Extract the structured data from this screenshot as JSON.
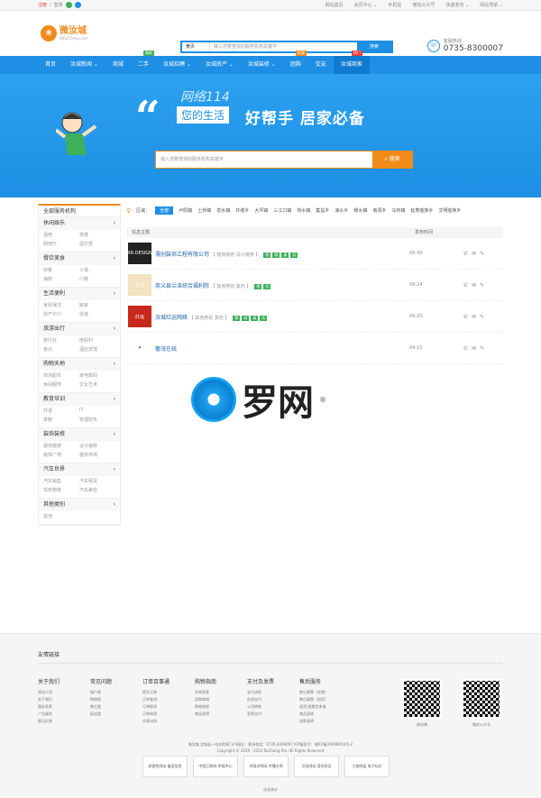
{
  "topbar": {
    "login": "注册",
    "sep": "/",
    "register": "登录",
    "links": [
      "网站首页",
      "会员中心 ⌄",
      "手机站",
      "微信公众号",
      "快速发布 ⌄",
      "网站导航 ⌄"
    ]
  },
  "header": {
    "logo_text": "微汝城",
    "logo_sub": "WRuCheng.com",
    "search_select": "黄页",
    "search_placeholder": "输入您要查找的服务机构关键字",
    "search_button": "搜索",
    "hotline_label": "客服热线",
    "hotline_number": "0735-8300007"
  },
  "nav": {
    "items": [
      {
        "label": "首页",
        "badge": ""
      },
      {
        "label": "汝城新闻 ⌄",
        "badge": ""
      },
      {
        "label": "商城",
        "badge": ""
      },
      {
        "label": "二手",
        "badge": "最新"
      },
      {
        "label": "汝城招聘 ⌄",
        "badge": ""
      },
      {
        "label": "汝城房产 ⌄",
        "badge": ""
      },
      {
        "label": "汝城装修 ⌄",
        "badge": ""
      },
      {
        "label": "团购",
        "badge": "优惠"
      },
      {
        "label": "交友",
        "badge": ""
      },
      {
        "label": "汝城商家",
        "badge": "热门"
      }
    ]
  },
  "banner": {
    "net": "网络114",
    "quote": "“",
    "life": "您的生活",
    "slogan": "好帮手 居家必备",
    "search_placeholder": "输入您要查找的服务机构关键字",
    "search_button": "搜索"
  },
  "sidebar": {
    "title": "全部服务机构",
    "cats": [
      {
        "name": "休闲娱乐",
        "links": [
          "酒吧",
          "茶楼",
          "网吧厅",
          "俱乐部"
        ]
      },
      {
        "name": "餐饮美食",
        "links": [
          "快餐",
          "火锅",
          "海鲜",
          "川菜"
        ]
      },
      {
        "name": "生活便利",
        "links": [
          "家政保洁",
          "搬家",
          "房产中介",
          "快递"
        ]
      },
      {
        "name": "旅游出行",
        "links": [
          "旅行社",
          "度假村",
          "景点",
          "酒店宾馆"
        ]
      },
      {
        "name": "购物天地",
        "links": [
          "商场超市",
          "家电数码",
          "休闲服饰",
          "文化艺术"
        ]
      },
      {
        "name": "教育培训",
        "links": [
          "外语",
          "IT",
          "家教",
          "管理财务"
        ]
      },
      {
        "name": "装饰装修",
        "links": [
          "装饰装修",
          "设计装修",
          "装饰广场",
          "建材市场"
        ]
      },
      {
        "name": "汽车世界",
        "links": [
          "汽车销售",
          "汽车租赁",
          "驾校陪练",
          "汽车美容"
        ]
      },
      {
        "name": "其他类别",
        "links": [
          "其他",
          ""
        ]
      }
    ]
  },
  "content": {
    "area_label": "区域：",
    "area_tags": [
      "全部",
      "卢阳镇",
      "土桥镇",
      "泉水镇",
      "井坡乡",
      "大坪镇",
      "三江口镇",
      "热水镇",
      "集益乡",
      "濠头乡",
      "暖水镇",
      "南洞乡",
      "马桥镇",
      "延寿瑶族乡",
      "文明瑶族乡"
    ],
    "col_title": "信息主题",
    "col_date": "发布时间",
    "rows": [
      {
        "name": "濡创装饰工程有限公司",
        "desc": "【 装饰装修 设计装修 】",
        "tags": [
          "税",
          "商",
          "真",
          "实"
        ],
        "date": "09-30",
        "thumb_color": "#222",
        "thumb_text": "RR·DESIGN"
      },
      {
        "name": "崇义县兰泽综合福利院",
        "desc": "【 其他类别 其他 】",
        "tags": [
          "税",
          "实"
        ],
        "date": "09-24",
        "thumb_color": "#f3e3c0",
        "thumb_text": "兰泽"
      },
      {
        "name": "汝城红运网络",
        "desc": "【 其他类别 其他 】",
        "tags": [
          "税",
          "商",
          "真",
          "实"
        ],
        "date": "09-20",
        "thumb_color": "#c8281e",
        "thumb_text": "红运"
      },
      {
        "name": "奢茂在线",
        "desc": "",
        "tags": [],
        "date": "04-11",
        "thumb_color": "#fff",
        "thumb_text": "✦"
      }
    ]
  },
  "watermark": {
    "text": "罗网",
    "reg": "®"
  },
  "footer": {
    "links_title": "友情链接",
    "cols": [
      {
        "h": "关于我们",
        "items": [
          "网站介绍",
          "关于我们",
          "服务条款",
          "广告服务",
          "意见反馈"
        ]
      },
      {
        "h": "常见问题",
        "items": [
          "账户类",
          "购物类",
          "售后类",
          "配送类"
        ]
      },
      {
        "h": "订单百事通",
        "items": [
          "提交订单",
          "订单查询",
          "订单取消",
          "订单修改",
          "交易纠纷"
        ]
      },
      {
        "h": "购物指南",
        "items": [
          "交易条款",
          "团购商城",
          "购物流程",
          "商品说明"
        ]
      },
      {
        "h": "支付及发票",
        "items": [
          "支付流程",
          "在线支付",
          "公司转账",
          "发票支付"
        ]
      },
      {
        "h": "售后服务",
        "items": [
          "售后政策（在售）",
          "售后政策（退货）",
          "退货/退换货申请",
          "商品返修",
          "退款说明"
        ]
      }
    ],
    "qr_labels": [
      "移动端",
      "微信公众号"
    ],
    "copy1": "微汝城 汝城县一站式的家门户网站！ 联系电话：0735-8300007 ICP备案号：湘ICP备19008050号-2",
    "copy2": "Copyright © 2019 - 2022 RuCheng.Pro. All Rights Reserved",
    "badges": [
      "经营性网站 备案信息",
      "中国互联网 举报中心",
      "中国文明网 传播文明",
      "可信网站 身份验证",
      "工商网监 电子标识"
    ],
    "stats": "站长统计"
  }
}
